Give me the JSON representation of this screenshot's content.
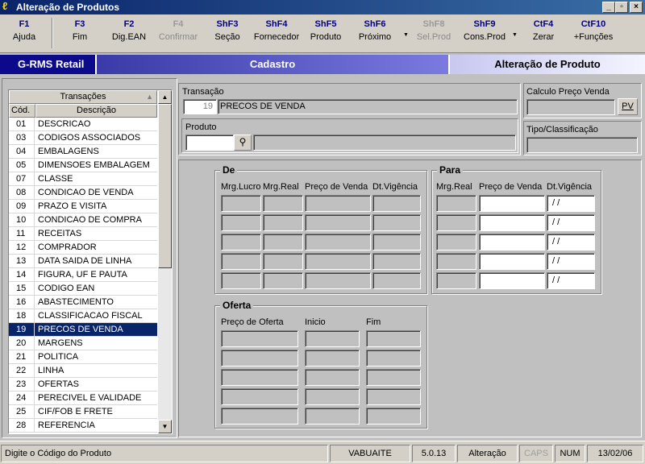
{
  "window": {
    "title": "Alteração de Produtos",
    "min": "_",
    "max": "▫",
    "close": "×"
  },
  "toolbar": [
    {
      "key": "F1",
      "label": "Ajuda",
      "enabled": true
    },
    {
      "key": "F3",
      "label": "Fim",
      "enabled": true
    },
    {
      "key": "F2",
      "label": "Dig.EAN",
      "enabled": true
    },
    {
      "key": "F4",
      "label": "Confirmar",
      "enabled": false
    },
    {
      "key": "ShF3",
      "label": "Seção",
      "enabled": true
    },
    {
      "key": "ShF4",
      "label": "Fornecedor",
      "enabled": true
    },
    {
      "key": "ShF5",
      "label": "Produto",
      "enabled": true
    },
    {
      "key": "ShF6",
      "label": "Próximo",
      "enabled": true
    },
    {
      "key": "ShF8",
      "label": "Sel.Prod",
      "enabled": false
    },
    {
      "key": "ShF9",
      "label": "Cons.Prod",
      "enabled": true
    },
    {
      "key": "CtF4",
      "label": "Zerar",
      "enabled": true
    },
    {
      "key": "CtF10",
      "label": "+Funções",
      "enabled": true
    }
  ],
  "band": {
    "app": "G-RMS Retail",
    "module": "Cadastro",
    "screen": "Alteração de Produto"
  },
  "transacoes": {
    "title": "Transações",
    "col_cod": "Cód.",
    "col_desc": "Descrição",
    "rows": [
      {
        "cod": "01",
        "desc": "DESCRICAO"
      },
      {
        "cod": "03",
        "desc": "CODIGOS ASSOCIADOS"
      },
      {
        "cod": "04",
        "desc": "EMBALAGENS"
      },
      {
        "cod": "05",
        "desc": "DIMENSOES EMBALAGEM"
      },
      {
        "cod": "07",
        "desc": "CLASSE"
      },
      {
        "cod": "08",
        "desc": "CONDICAO DE VENDA"
      },
      {
        "cod": "09",
        "desc": "PRAZO E VISITA"
      },
      {
        "cod": "10",
        "desc": "CONDICAO DE COMPRA"
      },
      {
        "cod": "11",
        "desc": "RECEITAS"
      },
      {
        "cod": "12",
        "desc": "COMPRADOR"
      },
      {
        "cod": "13",
        "desc": "DATA SAIDA DE LINHA"
      },
      {
        "cod": "14",
        "desc": "FIGURA, UF E PAUTA"
      },
      {
        "cod": "15",
        "desc": "CODIGO EAN"
      },
      {
        "cod": "16",
        "desc": "ABASTECIMENTO"
      },
      {
        "cod": "18",
        "desc": "CLASSIFICACAO FISCAL"
      },
      {
        "cod": "19",
        "desc": "PRECOS DE VENDA",
        "selected": true
      },
      {
        "cod": "20",
        "desc": "MARGENS"
      },
      {
        "cod": "21",
        "desc": "POLITICA"
      },
      {
        "cod": "22",
        "desc": "LINHA"
      },
      {
        "cod": "23",
        "desc": "OFERTAS"
      },
      {
        "cod": "24",
        "desc": "PERECIVEL E VALIDADE"
      },
      {
        "cod": "25",
        "desc": "CIF/FOB E FRETE"
      },
      {
        "cod": "28",
        "desc": "REFERENCIA"
      }
    ]
  },
  "transacao": {
    "label": "Transação",
    "code": "19",
    "desc": "PRECOS DE VENDA"
  },
  "produto": {
    "label": "Produto",
    "code": "",
    "desc": ""
  },
  "calculo": {
    "label": "Calculo Preço Venda",
    "value": "",
    "button": "PV"
  },
  "tipo": {
    "label": "Tipo/Classificação",
    "value": ""
  },
  "de": {
    "title": "De",
    "headers": [
      "Mrg.Lucro",
      "Mrg.Real",
      "Preço de Venda",
      "Dt.Vigência"
    ],
    "rows": 5
  },
  "para": {
    "title": "Para",
    "headers": [
      "Mrg.Real",
      "Preço de Venda",
      "Dt.Vigência"
    ],
    "date_placeholder": " / /",
    "rows": 5
  },
  "oferta": {
    "title": "Oferta",
    "headers": [
      "Preço de Oferta",
      "Inicio",
      "Fim"
    ],
    "rows": 5
  },
  "status": {
    "message": "Digite o Código do Produto",
    "user": "VABUAITE",
    "version": "5.0.13",
    "mode": "Alteração",
    "caps": "CAPS",
    "num": "NUM",
    "date": "13/02/06"
  }
}
